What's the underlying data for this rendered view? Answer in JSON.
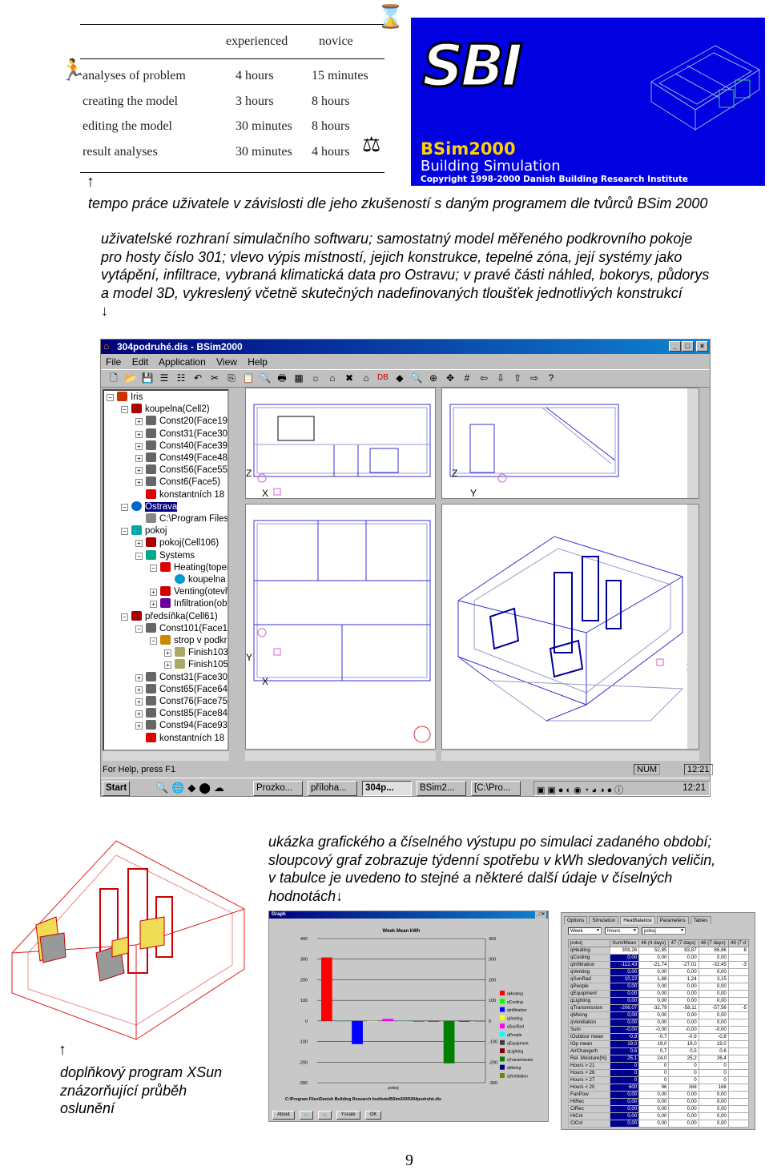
{
  "experience_table": {
    "headers": [
      "experienced",
      "novice"
    ],
    "rows": [
      {
        "task": "analyses of problem",
        "experienced": "4 hours",
        "novice": "15 minutes"
      },
      {
        "task": "creating the model",
        "experienced": "3 hours",
        "novice": "8 hours"
      },
      {
        "task": "editing the model",
        "experienced": "30 minutes",
        "novice": "8 hours"
      },
      {
        "task": "result analyses",
        "experienced": "30 minutes",
        "novice": "4 hours"
      }
    ]
  },
  "logo": {
    "brand": "SBI",
    "product": "BSim2000",
    "subtitle": "Building Simulation",
    "copyright": "Copyright 1998-2000 Danish Building Research Institute",
    "bg_color": "#0000e0"
  },
  "captions": {
    "arrow_up": "↑",
    "caption1": "tempo práce uživatele v závislosti dle jeho zkušeností s daným programem dle tvůrců BSim 2000",
    "caption2_lines": [
      "uživatelské rozhraní simulačního softwaru; samostatný model měřeného podkrovního pokoje",
      "pro hosty číslo  301; vlevo výpis místností, jejich konstrukce, tepelné zóna, její systémy jako",
      "vytápění, infiltrace, vybraná klimatická data pro Ostravu; v pravé části náhled, bokorys, půdorys",
      "a model 3D, vykreslený včetně skutečných nadefinovaných tloušťek jednotlivých konstrukcí"
    ],
    "arrow_down": "↓",
    "caption3_lines": [
      "ukázka grafického a číselného výstupu po simulaci zadaného období;",
      "sloupcový graf zobrazuje týdenní spotřebu v kWh sledovaných veličin,",
      "v tabulce je uvedeno to stejné a některé další údaje v číselných",
      "hodnotách↓"
    ],
    "caption4_lines": [
      "doplňkový program XSun",
      "znázorňující průběh",
      "oslunění"
    ],
    "page_number": "9"
  },
  "window": {
    "title": "304podruhé.dis - BSim2000",
    "controls": [
      "_",
      "□",
      "×"
    ],
    "menu": [
      "File",
      "Edit",
      "Application",
      "View",
      "Help"
    ],
    "toolbar_icons": [
      "new-icon",
      "open-icon",
      "save-icon",
      "tree-icon",
      "tree-red-icon",
      "undo-icon",
      "cut-icon",
      "copy-icon",
      "paste-icon",
      "print-preview-icon",
      "print-icon",
      "climate-icon",
      "sun-icon",
      "house-icon",
      "delete-icon",
      "zone-icon",
      "db-icon",
      "shape-icon",
      "zoom-icon",
      "zoom-area-icon",
      "pan-icon",
      "grid-icon",
      "left-icon",
      "down-icon",
      "up-icon",
      "right-icon",
      "help-icon"
    ],
    "tree": [
      {
        "label": "Iris",
        "level": 0,
        "exp": "−",
        "icon": "house"
      },
      {
        "label": "koupelna(Cell2)",
        "level": 1,
        "exp": "−",
        "icon": "cell"
      },
      {
        "label": "Const20(Face19)",
        "level": 2,
        "exp": "+",
        "icon": "face"
      },
      {
        "label": "Const31(Face30)",
        "level": 2,
        "exp": "+",
        "icon": "face"
      },
      {
        "label": "Const40(Face39)",
        "level": 2,
        "exp": "+",
        "icon": "face"
      },
      {
        "label": "Const49(Face48)",
        "level": 2,
        "exp": "+",
        "icon": "face"
      },
      {
        "label": "Const56(Face55)",
        "level": 2,
        "exp": "+",
        "icon": "face"
      },
      {
        "label": "Const6(Face5)",
        "level": 2,
        "exp": "+",
        "icon": "face"
      },
      {
        "label": "konstantních 18",
        "level": 2,
        "exp": "",
        "icon": "thermo"
      },
      {
        "label": "Ostrava",
        "level": 1,
        "exp": "−",
        "icon": "globe",
        "selected": true
      },
      {
        "label": "C:\\Program Files\\D",
        "level": 2,
        "exp": "",
        "icon": "file"
      },
      {
        "label": "pokoj",
        "level": 1,
        "exp": "−",
        "icon": "zone"
      },
      {
        "label": "pokoj(Cell106)",
        "level": 2,
        "exp": "+",
        "icon": "cell"
      },
      {
        "label": "Systems",
        "level": 2,
        "exp": "−",
        "icon": "systems"
      },
      {
        "label": "Heating(topen",
        "level": 3,
        "exp": "−",
        "icon": "heating"
      },
      {
        "label": "koupelna '",
        "level": 4,
        "exp": "",
        "icon": "radiator"
      },
      {
        "label": "Venting(otevře",
        "level": 3,
        "exp": "+",
        "icon": "venting"
      },
      {
        "label": "Infiltration(obyč",
        "level": 3,
        "exp": "+",
        "icon": "infiltration"
      },
      {
        "label": "předsíňka(Cell61)",
        "level": 1,
        "exp": "−",
        "icon": "cell"
      },
      {
        "label": "Const101(Face10(",
        "level": 2,
        "exp": "−",
        "icon": "face"
      },
      {
        "label": "strop v podkro",
        "level": 3,
        "exp": "−",
        "icon": "layers"
      },
      {
        "label": "Finish103(",
        "level": 4,
        "exp": "+",
        "icon": "finish"
      },
      {
        "label": "Finish105(",
        "level": 4,
        "exp": "+",
        "icon": "finish"
      },
      {
        "label": "Const31(Face30)",
        "level": 2,
        "exp": "+",
        "icon": "face"
      },
      {
        "label": "Const65(Face64)",
        "level": 2,
        "exp": "+",
        "icon": "face"
      },
      {
        "label": "Const76(Face75)",
        "level": 2,
        "exp": "+",
        "icon": "face"
      },
      {
        "label": "Const85(Face84)",
        "level": 2,
        "exp": "+",
        "icon": "face"
      },
      {
        "label": "Const94(Face93)",
        "level": 2,
        "exp": "+",
        "icon": "face"
      },
      {
        "label": "konstantních 18",
        "level": 2,
        "exp": "",
        "icon": "thermo"
      }
    ],
    "view_axes": {
      "front": [
        "Z",
        "X"
      ],
      "side": [
        "Z",
        "Y"
      ],
      "plan": [
        "Y",
        "X"
      ],
      "iso": [
        "X",
        "Y"
      ]
    },
    "status_text": "For Help, press F1",
    "status_num": "NUM",
    "status_time": "12:21",
    "taskbar": {
      "start": "Start",
      "tasks": [
        "Prozko...",
        "příloha...",
        "304p...",
        "BSim2...",
        "[C:\\Pro..."
      ],
      "clock": "12:21"
    }
  },
  "graph": {
    "window_title": "Graph",
    "buttons": [
      "About",
      "⇦",
      "⇨",
      "Yscale",
      "OK"
    ],
    "path": "C:\\Program Files\\Danish Building Research Institute\\BSim2000\\304podruhé.dis"
  },
  "chart_data": {
    "type": "bar",
    "title": "Week Mean kWh",
    "xlabel": "pokoj",
    "ylim": [
      -300,
      400
    ],
    "yticks": [
      400,
      300,
      200,
      100,
      0,
      -100,
      -200,
      -300
    ],
    "grid": true,
    "legend_position": "right",
    "series": [
      {
        "name": "qHeating",
        "value": 308.26,
        "color": "#ff0000"
      },
      {
        "name": "qCooling",
        "value": 0,
        "color": "#00ff00"
      },
      {
        "name": "qInfiltration",
        "value": -112.43,
        "color": "#0000ff"
      },
      {
        "name": "qVenting",
        "value": 0,
        "color": "#ffff00"
      },
      {
        "name": "qSunRad",
        "value": 10.22,
        "color": "#ff00ff"
      },
      {
        "name": "qPeople",
        "value": 0,
        "color": "#00ffff"
      },
      {
        "name": "qEquipment",
        "value": 0,
        "color": "#404040"
      },
      {
        "name": "qLighting",
        "value": 0,
        "color": "#800000"
      },
      {
        "name": "qTransmission",
        "value": -206.07,
        "color": "#008000"
      },
      {
        "name": "qMixing",
        "value": 0,
        "color": "#000080"
      },
      {
        "name": "qVentilation",
        "value": 0,
        "color": "#808000"
      }
    ]
  },
  "heat_balance": {
    "tabs": [
      "Options",
      "Simulation",
      "HeatBalance",
      "Parameters",
      "Tables"
    ],
    "active_tab": "HeatBalance",
    "selects": [
      "Week",
      "Hours",
      "pokoj"
    ],
    "columns": [
      "pokoj",
      "Sum/Mean",
      "46 (4 days)",
      "47 (7 days)",
      "48 (7 days)",
      "49 (7 d"
    ],
    "rows": [
      [
        "qHeating",
        "308,26",
        "52,85",
        "83,87",
        "86,86",
        "8"
      ],
      [
        "qCooling",
        "0,00",
        "0,00",
        "0,00",
        "0,00",
        ""
      ],
      [
        "qInfiltration",
        "-112,43",
        "-21,74",
        "-27,01",
        "-32,45",
        "-3"
      ],
      [
        "qVenting",
        "0,00",
        "0,00",
        "0,00",
        "0,00",
        ""
      ],
      [
        "qSunRad",
        "10,22",
        "1,68",
        "1,24",
        "3,15",
        ""
      ],
      [
        "qPeople",
        "0,00",
        "0,00",
        "0,00",
        "0,00",
        ""
      ],
      [
        "qEquipment",
        "0,00",
        "0,00",
        "0,00",
        "0,00",
        ""
      ],
      [
        "qLighting",
        "0,00",
        "0,00",
        "0,00",
        "0,00",
        ""
      ],
      [
        "qTransmission",
        "-206,07",
        "-32,79",
        "-58,11",
        "-57,56",
        "-5"
      ],
      [
        "qMixing",
        "0,00",
        "0,00",
        "0,00",
        "0,00",
        ""
      ],
      [
        "qVentilation",
        "0,00",
        "0,00",
        "0,00",
        "0,00",
        ""
      ],
      [
        "Sum",
        "-0,00",
        "-0,00",
        "-0,00",
        "-0,00",
        ""
      ],
      [
        "tOutdoor mean",
        "-0,8",
        "-0,7",
        "-0,9",
        "-0,8",
        ""
      ],
      [
        "tOp mean",
        "19,0",
        "19,0",
        "19,0",
        "19,0",
        ""
      ],
      [
        "AirChange/h",
        "0,6",
        "0,7",
        "0,5",
        "0,6",
        ""
      ],
      [
        "Rel. Moisture[%]",
        "25,1",
        "24,0",
        "25,2",
        "26,4",
        ""
      ],
      [
        "Hours > 21",
        "0",
        "0",
        "0",
        "0",
        ""
      ],
      [
        "Hours > 26",
        "0",
        "0",
        "0",
        "0",
        ""
      ],
      [
        "Hours > 27",
        "0",
        "0",
        "0",
        "0",
        ""
      ],
      [
        "Hours < 20",
        "600",
        "96",
        "168",
        "168",
        ""
      ],
      [
        "FanPow",
        "0,00",
        "0,00",
        "0,00",
        "0,00",
        ""
      ],
      [
        "HtRec",
        "0,00",
        "0,00",
        "0,00",
        "0,00",
        ""
      ],
      [
        "ClRec",
        "0,00",
        "0,00",
        "0,00",
        "0,00",
        ""
      ],
      [
        "HtCol",
        "0,00",
        "0,00",
        "0,00",
        "0,00",
        ""
      ],
      [
        "ClCol",
        "0,00",
        "0,00",
        "0,00",
        "0,00",
        ""
      ]
    ]
  }
}
